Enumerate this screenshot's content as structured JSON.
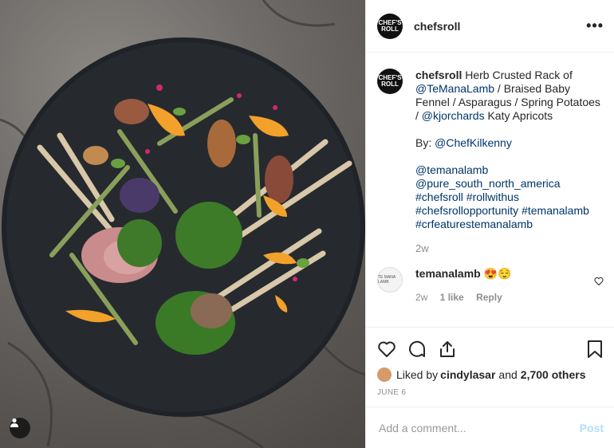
{
  "post": {
    "username": "chefsroll",
    "avatar_text": "CHEF'S ROLL",
    "more_label": "•••",
    "caption": {
      "username": "chefsroll",
      "t1": " Herb Crusted Rack of ",
      "m1": "@TeManaLamb",
      "t2": " / Braised Baby Fennel / Asparagus / Spring Potatoes / ",
      "m2": "@kjorchards",
      "t3": " Katy Apricots",
      "by_label": "By: ",
      "by_mention": "@ChefKilkenny",
      "tags": "@temanalamb @pure_south_north_america #chefsroll #rollwithus #chefsrollopportunity #temanalamb #crfeaturestemanalamb",
      "time": "2w"
    },
    "comment": {
      "username": "temanalamb",
      "avatar_text": "TE MANA LAMB",
      "text": "😍😌",
      "time": "2w",
      "likes": "1 like",
      "reply": "Reply"
    },
    "likes": {
      "prefix": "Liked by ",
      "user": "cindylasar",
      "middle": " and ",
      "count": "2,700 others"
    },
    "date": "JUNE 6",
    "add_comment_placeholder": "Add a comment...",
    "post_button": "Post"
  }
}
